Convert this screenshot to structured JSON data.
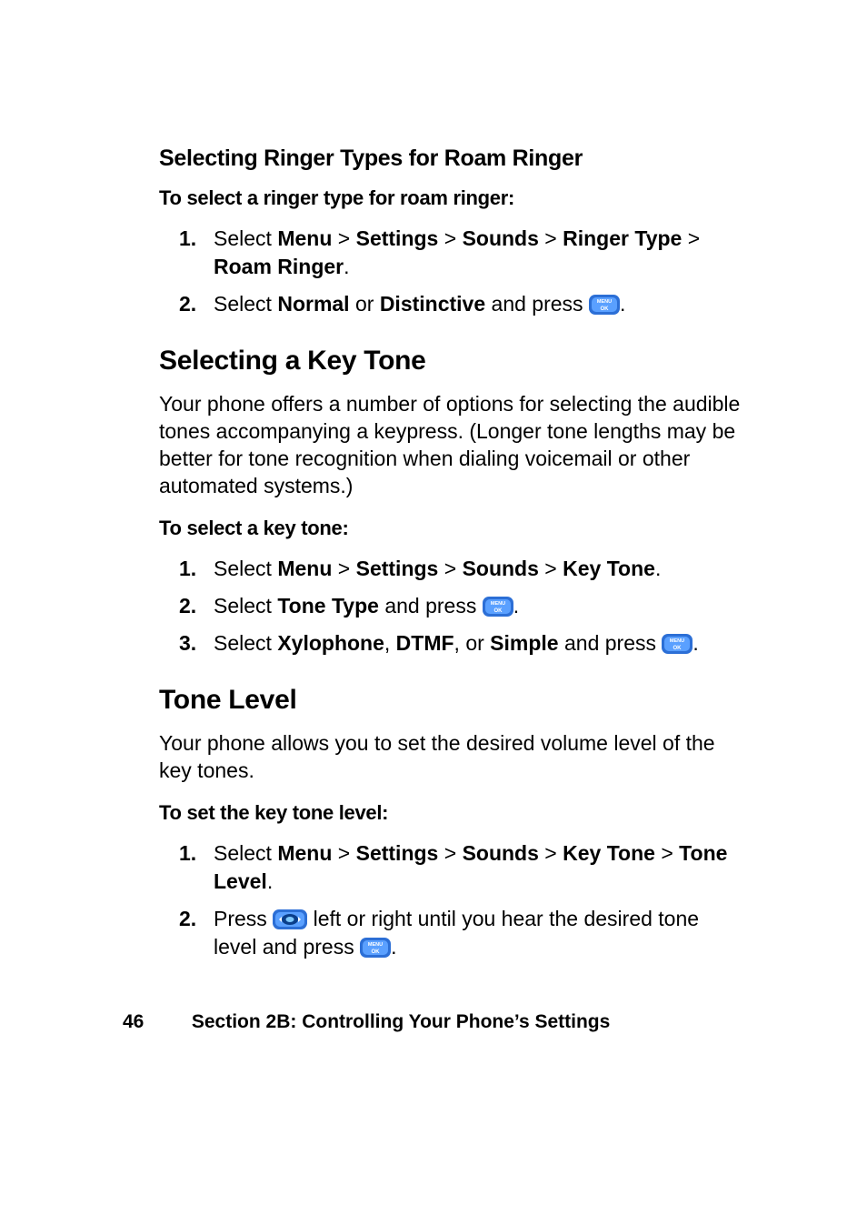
{
  "section1": {
    "heading": "Selecting Ringer Types for Roam Ringer",
    "intro": "To select a ringer type for roam ringer:",
    "steps": {
      "s1": {
        "num": "1.",
        "t_select": "Select ",
        "menu": "Menu",
        "sep": " > ",
        "settings": "Settings",
        "sounds": "Sounds",
        "ringer_type": "Ringer Type",
        "roam_ringer": "Roam Ringer",
        "period": "."
      },
      "s2": {
        "num": "2.",
        "t_select": "Select ",
        "normal": "Normal",
        "or": " or ",
        "distinctive": "Distinctive",
        "and_press": " and press ",
        "period": "."
      }
    }
  },
  "section2": {
    "heading": "Selecting a Key Tone",
    "para": "Your phone offers a number of options for selecting the audible tones accompanying a keypress. (Longer tone lengths may be better for tone recognition when dialing voicemail or other automated systems.)",
    "intro": "To select a key tone:",
    "steps": {
      "s1": {
        "num": "1.",
        "t_select": "Select ",
        "menu": "Menu",
        "sep": " > ",
        "settings": "Settings",
        "sounds": "Sounds",
        "key_tone": "Key Tone",
        "period": "."
      },
      "s2": {
        "num": "2.",
        "t_select": "Select ",
        "tone_type": "Tone Type",
        "and_press": " and press ",
        "period": "."
      },
      "s3": {
        "num": "3.",
        "t_select": "Select ",
        "xylophone": "Xylophone",
        "comma": ", ",
        "dtmf": "DTMF",
        "or": ", or ",
        "simple": "Simple",
        "and_press": " and press ",
        "period": "."
      }
    }
  },
  "section3": {
    "heading": "Tone Level",
    "para": "Your phone allows you to set the desired volume level of the key tones.",
    "intro": "To set the key tone level:",
    "steps": {
      "s1": {
        "num": "1.",
        "t_select": "Select ",
        "menu": "Menu",
        "sep": " > ",
        "settings": "Settings",
        "sounds": "Sounds",
        "key_tone": "Key Tone",
        "tone_level": "Tone Level",
        "period": "."
      },
      "s2": {
        "num": "2.",
        "press": "Press ",
        "rest1": " left or right until you hear the desired tone level and press ",
        "period": "."
      }
    }
  },
  "footer": {
    "page_number": "46",
    "section_label": "Section 2B: Controlling Your Phone’s Settings"
  },
  "icons": {
    "menu_ok": "menu-ok-button-icon",
    "nav": "navigation-pad-icon"
  }
}
